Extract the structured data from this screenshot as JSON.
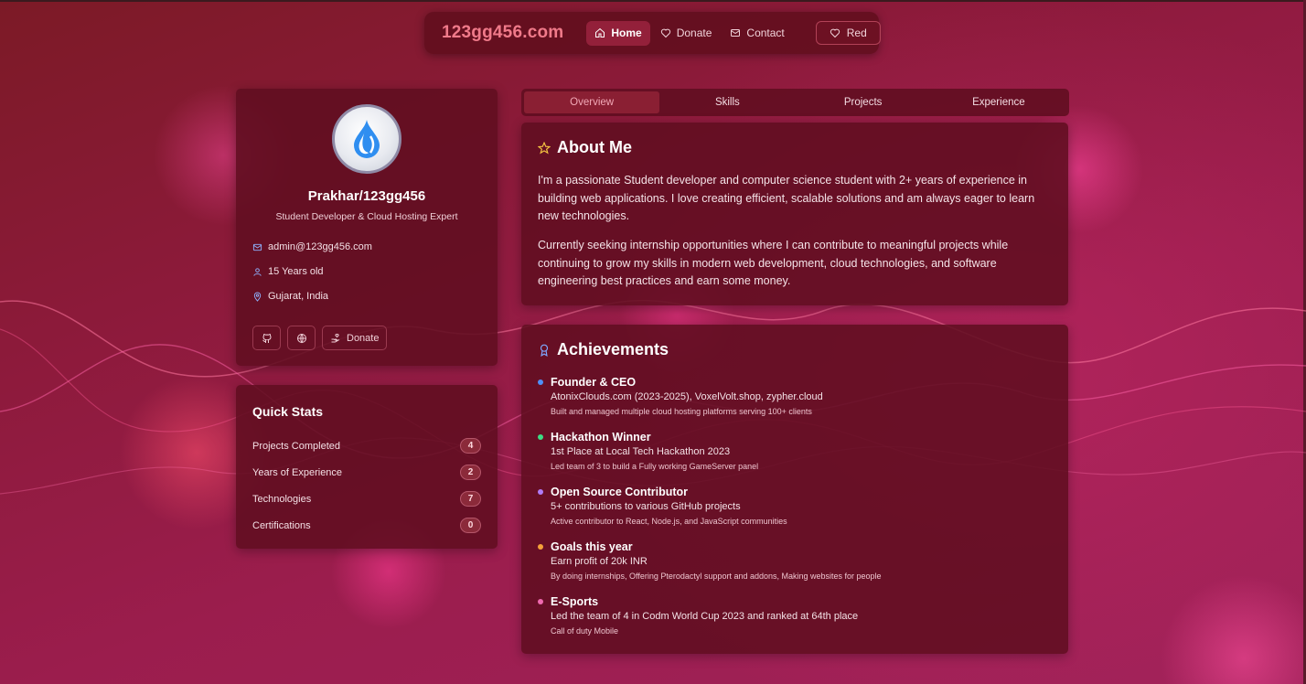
{
  "nav": {
    "brand": "123gg456.com",
    "items": [
      {
        "label": "Home",
        "icon": "home-icon",
        "active": true
      },
      {
        "label": "Donate",
        "icon": "heart-icon"
      },
      {
        "label": "Contact",
        "icon": "mail-icon"
      }
    ],
    "theme_button": "Red"
  },
  "profile": {
    "name": "Prakhar/123gg456",
    "role": "Student Developer & Cloud Hosting Expert",
    "email": "admin@123gg456.com",
    "age": "15 Years old",
    "location": "Gujarat, India",
    "donate_label": "Donate"
  },
  "stats": {
    "title": "Quick Stats",
    "rows": [
      {
        "label": "Projects Completed",
        "value": "4"
      },
      {
        "label": "Years of Experience",
        "value": "2"
      },
      {
        "label": "Technologies",
        "value": "7"
      },
      {
        "label": "Certifications",
        "value": "0"
      }
    ]
  },
  "tabs": [
    "Overview",
    "Skills",
    "Projects",
    "Experience"
  ],
  "about": {
    "title": "About Me",
    "paragraphs": [
      "I'm a passionate Student developer and computer science student with 2+ years of experience in building web applications. I love creating efficient, scalable solutions and am always eager to learn new technologies.",
      "Currently seeking internship opportunities where I can contribute to meaningful projects while continuing to grow my skills in modern web development, cloud technologies, and software engineering best practices and earn some money."
    ]
  },
  "achievements": {
    "title": "Achievements",
    "items": [
      {
        "title": "Founder & CEO",
        "sub": "AtonixClouds.com (2023-2025), VoxelVolt.shop, zypher.cloud",
        "desc": "Built and managed multiple cloud hosting platforms serving 100+ clients",
        "color": "#4f8ff7"
      },
      {
        "title": "Hackathon Winner",
        "sub": "1st Place at Local Tech Hackathon 2023",
        "desc": "Led team of 3 to build a Fully working GameServer panel",
        "color": "#3ddc84"
      },
      {
        "title": "Open Source Contributor",
        "sub": "5+ contributions to various GitHub projects",
        "desc": "Active contributor to React, Node.js, and JavaScript communities",
        "color": "#b07cf7"
      },
      {
        "title": "Goals this year",
        "sub": "Earn profit of 20k INR",
        "desc": "By doing internships, Offering Pterodactyl support and addons, Making websites for people",
        "color": "#f5a13a"
      },
      {
        "title": "E-Sports",
        "sub": "Led the team of 4 in Codm World Cup 2023 and ranked at 64th place",
        "desc": "Call of duty Mobile",
        "color": "#f06ab0"
      }
    ]
  },
  "colors": {
    "accent": "#f07a8a",
    "card": "#600e20",
    "badge": "#8b2a3a"
  }
}
